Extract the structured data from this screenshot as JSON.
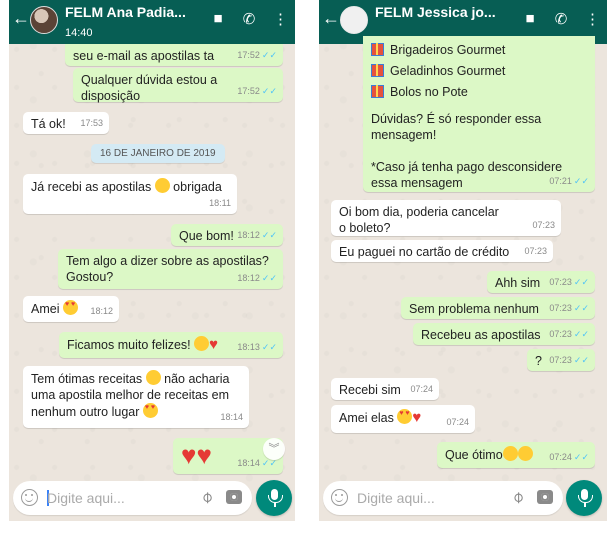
{
  "left_chat": {
    "contact_name": "FELM  Ana Padia...",
    "header_subtitle": "14:40",
    "messages": [
      {
        "text": "seu e-mail as apostilas ta",
        "time": "17:52"
      },
      {
        "text": "Qualquer dúvida estou a disposição",
        "time": "17:52"
      },
      {
        "text": "Tá ok!",
        "time": "17:53"
      },
      {
        "text": "Já recebi as apostilas",
        "text2": "obrigada",
        "time": "18:11"
      },
      {
        "text": "Que bom!",
        "time": "18:12"
      },
      {
        "text": "Tem algo a dizer sobre as apostilas?\nGostou?",
        "time": "18:12"
      },
      {
        "text": "Amei",
        "time": "18:12"
      },
      {
        "text": "Ficamos muito felizes!",
        "time": "18:13"
      },
      {
        "text": "Tem ótimas receitas",
        "text2": "não acharia\numa apostila melhor de receitas em\nnenhum outro lugar",
        "time": "18:14"
      },
      {
        "text": "",
        "time": "18:14"
      }
    ],
    "date_chip": "16 DE JANEIRO DE 2019",
    "composer_placeholder": "Digite aqui..."
  },
  "right_chat": {
    "contact_name": "FELM  Jessica jo...",
    "messages": [
      {
        "items": [
          "Brigadeiros Gourmet",
          "Geladinhos Gourmet",
          "Bolos no Pote"
        ],
        "text": "Dúvidas? É só responder essa\nmensagem!\n\n*Caso já tenha pago desconsidere\nessa mensagem",
        "time": "07:21"
      },
      {
        "text": "Oi bom dia, poderia cancelar\no boleto?",
        "time": "07:23"
      },
      {
        "text": "Eu paguei no cartão de crédito",
        "time": "07:23"
      },
      {
        "text": "Ahh sim",
        "time": "07:23"
      },
      {
        "text": "Sem problema nenhum",
        "time": "07:23"
      },
      {
        "text": "Recebeu as apostilas",
        "time": "07:23"
      },
      {
        "text": "?",
        "time": "07:23"
      },
      {
        "text": "Recebi sim",
        "time": "07:24"
      },
      {
        "text": "Amei elas",
        "time": "07:24"
      },
      {
        "text": "Que ótimo",
        "time": "07:24"
      }
    ],
    "composer_placeholder": "Digite aqui..."
  },
  "colors": {
    "header": "#075e54",
    "outgoing_bubble": "#dcf8c6",
    "incoming_bubble": "#ffffff",
    "chat_background": "#ece5dd",
    "mic_button": "#00897b",
    "read_ticks": "#4fc3f7"
  },
  "icons": [
    "back-arrow-icon",
    "video-call-icon",
    "phone-icon",
    "more-vert-icon",
    "emoji-icon",
    "attach-icon",
    "camera-icon",
    "mic-icon",
    "scroll-down-icon"
  ]
}
